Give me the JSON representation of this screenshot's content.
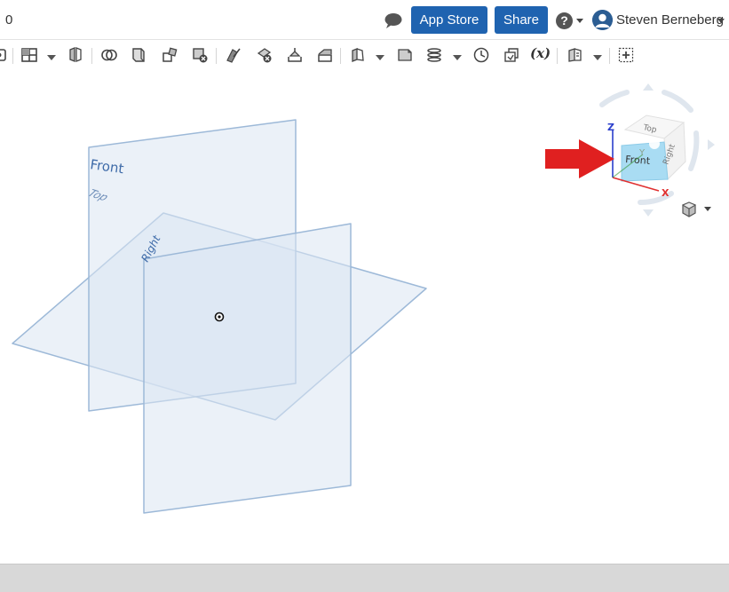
{
  "header": {
    "doc_number": "0",
    "app_store_label": "App Store",
    "share_label": "Share",
    "help_symbol": "?",
    "user_name": "Steven Berneberg"
  },
  "toolbar": {
    "variable_label": "(x)",
    "icons": [
      "sketch-icon",
      "layout-icon",
      "dropdown-caret",
      "mirror-part-icon",
      "boolean-icon",
      "extrude-face-icon",
      "transform-icon",
      "delete-part-icon",
      "split-icon",
      "delete-face-icon",
      "move-face-icon",
      "replace-face-icon",
      "sheet-metal-icon",
      "dropdown-caret",
      "plane-icon",
      "helix-icon",
      "dropdown-caret",
      "measure-icon",
      "assembly-icon",
      "variable-icon",
      "frame-icon",
      "dropdown-caret",
      "add-custom-feature-icon"
    ]
  },
  "planes": {
    "front_label": "Front",
    "top_label": "Top",
    "right_label": "Right"
  },
  "viewcube": {
    "top_label": "Top",
    "front_label": "Front",
    "right_label": "Right",
    "axis_z": "Z",
    "axis_y": "Y",
    "axis_x": "X"
  },
  "colors": {
    "accent_blue": "#1f63b0",
    "plane_fill": "#dbe6f3",
    "plane_stroke": "#9db9d8",
    "plane_label": "#3d6aa8",
    "arrow_red": "#e02020",
    "status_gray": "#d8d8d8"
  }
}
